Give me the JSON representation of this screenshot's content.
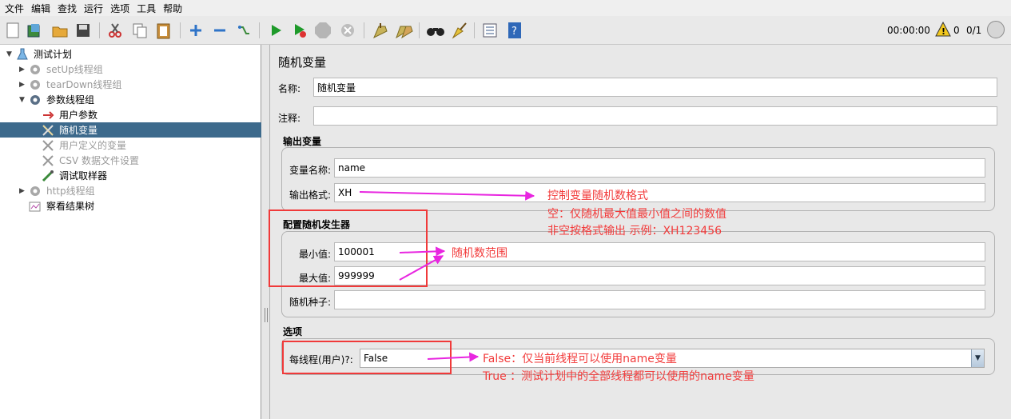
{
  "menu": [
    "文件",
    "编辑",
    "查找",
    "运行",
    "选项",
    "工具",
    "帮助"
  ],
  "toolbar": {
    "icons": [
      "new-icon",
      "templates-icon",
      "open-icon",
      "save-icon",
      "cut-icon",
      "copy-icon",
      "paste-icon",
      "expand-icon",
      "collapse-icon",
      "toggle-icon",
      "start-icon",
      "start-no-pause-icon",
      "stop-icon",
      "shutdown-icon",
      "clear-icon",
      "clear-all-icon",
      "search-icon",
      "reset-search-icon",
      "function-helper-icon",
      "help-icon"
    ],
    "timer": "00:00:00",
    "warning_count": "0",
    "thread_count": "0/1"
  },
  "tree": [
    {
      "label": "测试计划",
      "icon": "flask-icon"
    },
    {
      "label": "setUp线程组",
      "icon": "gear-icon"
    },
    {
      "label": "tearDown线程组",
      "icon": "gear-icon"
    },
    {
      "label": "参数线程组",
      "icon": "gear-icon"
    },
    {
      "label": "用户参数",
      "icon": "preprocessor-icon"
    },
    {
      "label": "随机变量",
      "icon": "wrench-icon"
    },
    {
      "label": "用户定义的变量",
      "icon": "wrench-icon"
    },
    {
      "label": "CSV 数据文件设置",
      "icon": "wrench-icon"
    },
    {
      "label": "调试取样器",
      "icon": "pipette-icon"
    },
    {
      "label": "http线程组",
      "icon": "gear-icon"
    },
    {
      "label": "察看结果树",
      "icon": "listener-icon"
    }
  ],
  "panel": {
    "title": "随机变量",
    "name_label": "名称:",
    "name_value": "随机变量",
    "comment_label": "注释:",
    "comment_value": "",
    "output_section": "输出变量",
    "var_name_label": "变量名称:",
    "var_name_value": "name",
    "format_label": "输出格式:",
    "format_value": "XH",
    "generator_section": "配置随机发生器",
    "min_label": "最小值:",
    "min_value": "100001",
    "max_label": "最大值:",
    "max_value": "999999",
    "seed_label": "随机种子:",
    "seed_value": "",
    "options_section": "选项",
    "per_thread_label": "每线程(用户)?:",
    "per_thread_value": "False"
  },
  "annotations": {
    "format_note_1": "控制变量随机数格式",
    "format_note_2": "空：仅随机最大值最小值之间的数值",
    "format_note_3": "非空按格式输出  示例：XH123456",
    "range_note": "随机数范围",
    "per_thread_note_1": "False：仅当前线程可以使用name变量",
    "per_thread_note_2": "True ：测试计划中的全部线程都可以使用的name变量",
    "color": "#f23b3b",
    "arrow_color": "#e826e0"
  }
}
